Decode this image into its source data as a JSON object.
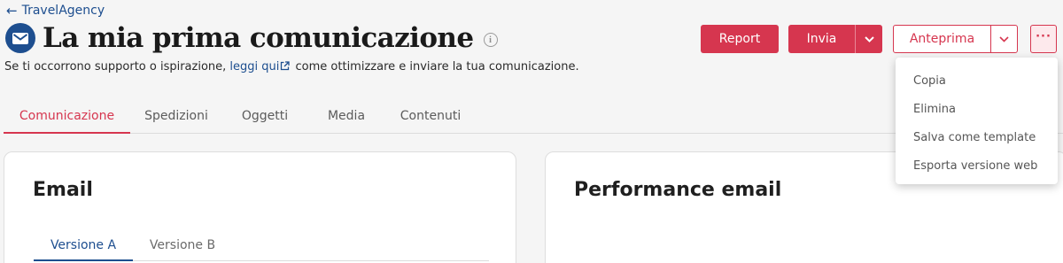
{
  "breadcrumb": {
    "label": "TravelAgency"
  },
  "header": {
    "title": "La mia prima comunicazione",
    "subtitle_before": "Se ti occorrono supporto o ispirazione, ",
    "subtitle_link": "leggi qui",
    "subtitle_after": " come ottimizzare e inviare la tua comunicazione."
  },
  "toolbar": {
    "report_label": "Report",
    "invia_label": "Invia",
    "anteprima_label": "Anteprima"
  },
  "tabs": [
    {
      "label": "Comunicazione",
      "active": true
    },
    {
      "label": "Spedizioni"
    },
    {
      "label": "Oggetti"
    },
    {
      "label": "Media"
    },
    {
      "label": "Contenuti"
    }
  ],
  "email_card": {
    "title": "Email",
    "versions": [
      {
        "label": "Versione A",
        "active": true
      },
      {
        "label": "Versione B"
      }
    ]
  },
  "performance_card": {
    "title": "Performance email"
  },
  "more_menu": {
    "items": [
      "Copia",
      "Elimina",
      "Salva come template",
      "Esporta versione web"
    ]
  },
  "colors": {
    "accent": "#d6364f",
    "brand": "#1d4e8f"
  },
  "icons": [
    "arrow-left-icon",
    "envelope-icon",
    "info-icon",
    "external-link-icon",
    "chevron-down-icon",
    "ellipsis-icon"
  ]
}
